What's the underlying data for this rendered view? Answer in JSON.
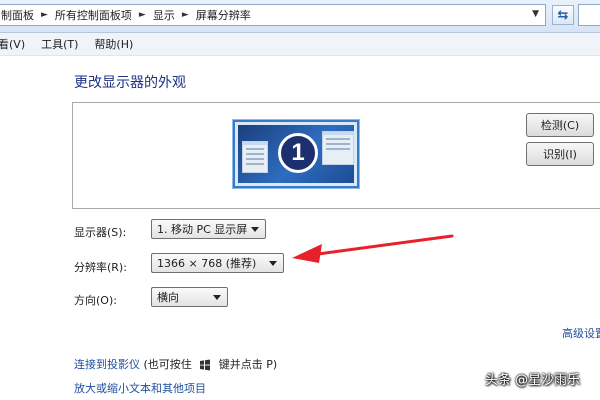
{
  "address_bar": {
    "crumbs": [
      "制面板",
      "所有控制面板项",
      "显示",
      "屏幕分辨率"
    ],
    "refresh_icon": "refresh-icon",
    "dropdown_icon": "chevron-down-icon"
  },
  "menu": {
    "items": [
      "看(V)",
      "工具(T)",
      "帮助(H)"
    ]
  },
  "main": {
    "title": "更改显示器的外观",
    "preview": {
      "monitor_number": "1"
    },
    "detect_button": "检测(C)",
    "identify_button": "识别(I)",
    "display_label": "显示器(S):",
    "display_value": "1. 移动 PC 显示屏",
    "resolution_label": "分辨率(R):",
    "resolution_value": "1366 × 768 (推荐)",
    "orientation_label": "方向(O):",
    "orientation_value": "横向",
    "advanced_link": "高级设置",
    "projector_link": "连接到投影仪",
    "projector_hint_prefix": "(也可按住",
    "projector_hint_suffix": "键并点击 P)",
    "text_size_link": "放大或缩小文本和其他项目"
  },
  "watermark": "头条 @星沙雨乐",
  "colors": {
    "link": "#1f4f9f",
    "title": "#1e3287",
    "annotation_arrow": "#e8202a"
  }
}
